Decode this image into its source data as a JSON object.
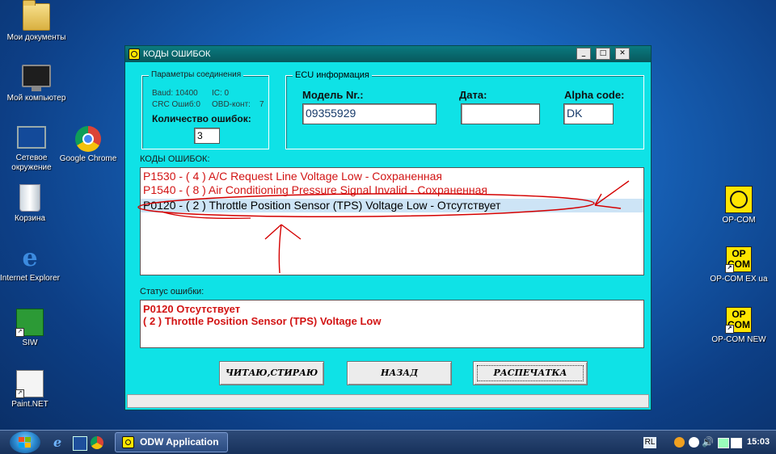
{
  "desktop_icons": {
    "my_documents": "Мои документы",
    "my_computer": "Мой компьютер",
    "network": "Сетевое окружение",
    "recycle_bin": "Корзина",
    "internet_explorer": "Internet Explorer",
    "siw": "SIW",
    "paint": "Paint.NET",
    "chrome": "Google Chrome",
    "opcom": "OP-COM",
    "opcom_ex": "OP-COM EX ua",
    "opcom_new": "OP-COM NEW",
    "op_label_line1": "OP",
    "op_label_line2": "COM"
  },
  "window": {
    "title": "КОДЫ ОШИБОК",
    "controls": {
      "minimize": "_",
      "maximize": "□",
      "close": "✕"
    },
    "connection": {
      "legend": "Параметры соединения",
      "baud": "Baud: 10400",
      "ic": "IC: 0",
      "crc": "CRC Ошиб:0",
      "obd": "OBD-конт:",
      "obd_value": "7",
      "count_label": "Количество ошибок:",
      "count_value": "3"
    },
    "ecu": {
      "legend": "ECU информация",
      "model_label": "Модель Nr.:",
      "model_value": "09355929",
      "date_label": "Дата:",
      "date_value": "",
      "alpha_label": "Alpha code:",
      "alpha_value": "DK"
    },
    "codes_label": "КОДЫ ОШИБОК:",
    "codes": [
      {
        "text": "P1530 - ( 4 )  A/C Request Line Voltage Low - Сохраненная"
      },
      {
        "text": "P1540 - ( 8 )  Air Conditioning Pressure Signal Invalid - Сохраненная"
      },
      {
        "text": "P0120 - ( 2 )  Throttle Position Sensor (TPS) Voltage Low - Отсутствует"
      }
    ],
    "selected_code_index": 2,
    "status_label": "Статус ошибки:",
    "status_lines": [
      "P0120  Отсутствует",
      "( 2 )  Throttle Position Sensor (TPS) Voltage Low"
    ],
    "buttons": {
      "read_clear": "ЧИТАЮ,СТИРАЮ",
      "back": "НАЗАД",
      "print": "РАСПЕЧАТКА"
    }
  },
  "taskbar": {
    "app_button": "ODW Application",
    "language": "RL",
    "time": "15:03"
  },
  "colors": {
    "window_bg": "#0fe2e6",
    "error_text": "#d21414",
    "annotation": "#d40000"
  }
}
